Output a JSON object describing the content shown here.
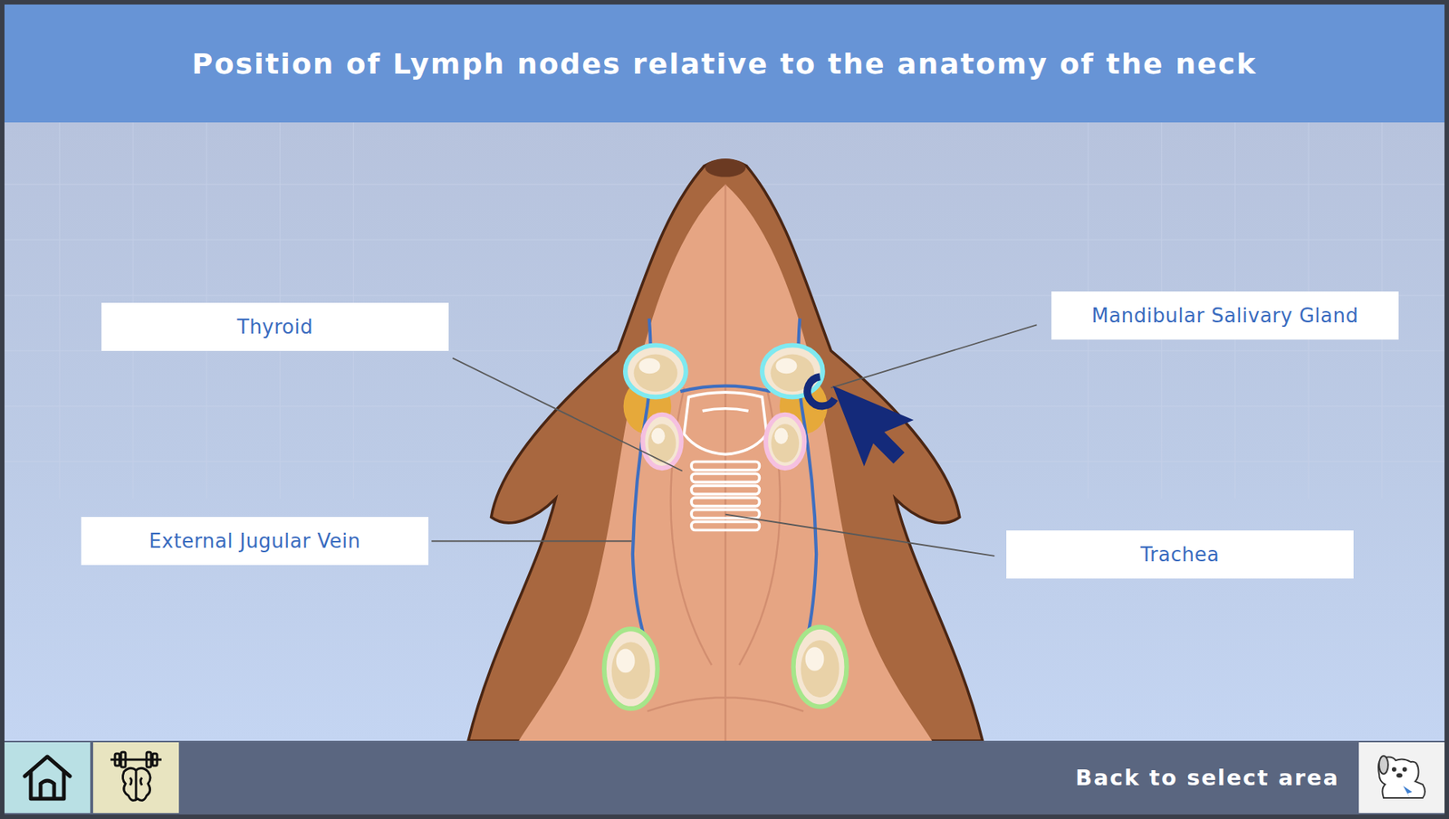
{
  "header": {
    "title": "Position of Lymph nodes relative to the anatomy of the neck"
  },
  "labels": [
    {
      "text": "Thyroid"
    },
    {
      "text": "Mandibular Salivary Gland"
    },
    {
      "text": "External Jugular Vein"
    },
    {
      "text": "Trachea"
    }
  ],
  "lymph_nodes": [
    {
      "color": "#7fe9f0"
    },
    {
      "color": "#f5c0e0"
    },
    {
      "color": "#a6e68a"
    }
  ],
  "footer": {
    "buttons": [
      {
        "kind": "home"
      },
      {
        "kind": "training"
      }
    ],
    "back_label": "Back to select area"
  }
}
